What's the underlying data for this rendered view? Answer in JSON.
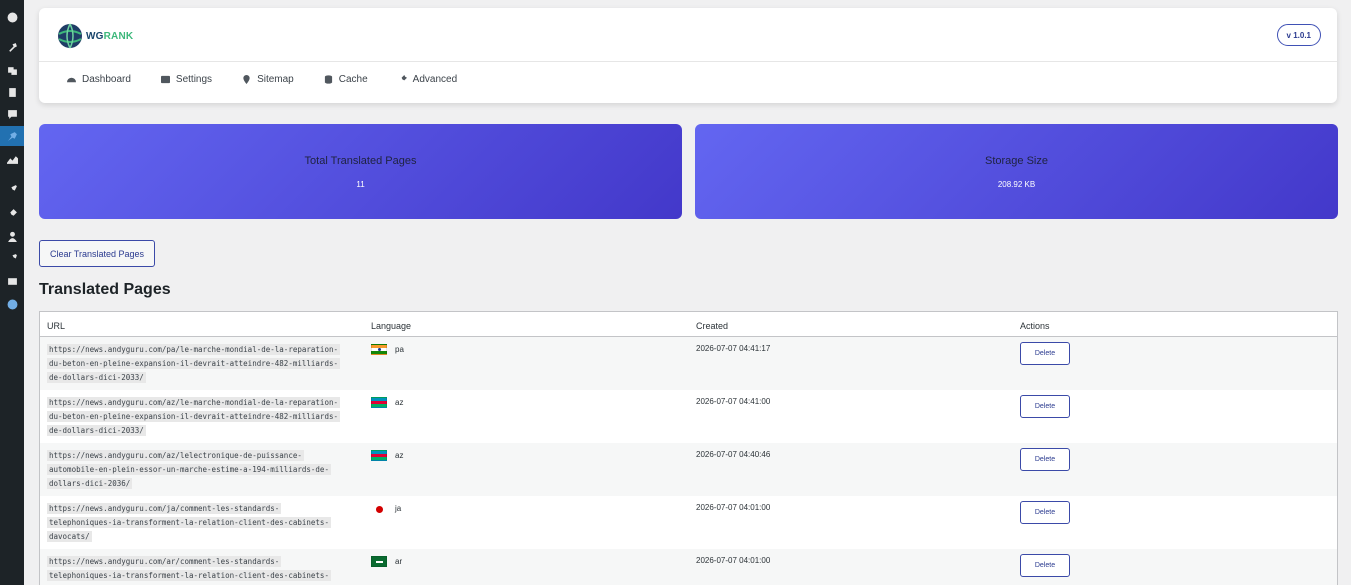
{
  "header": {
    "logo_text_wg": "WG",
    "logo_text_rank": "RANK",
    "version": "v 1.0.1"
  },
  "nav": [
    {
      "label": "Dashboard",
      "icon": "dashboard-icon"
    },
    {
      "label": "Settings",
      "icon": "settings-icon"
    },
    {
      "label": "Sitemap",
      "icon": "map-pin-icon"
    },
    {
      "label": "Cache",
      "icon": "database-icon"
    },
    {
      "label": "Advanced",
      "icon": "wrench-icon"
    }
  ],
  "stats": {
    "total_title": "Total Translated Pages",
    "total_value": "11",
    "storage_title": "Storage Size",
    "storage_value": "208.92 KB"
  },
  "clear_button": "Clear Translated Pages",
  "section_title": "Translated Pages",
  "table": {
    "headers": [
      "URL",
      "Language",
      "Created",
      "Actions"
    ],
    "rows": [
      {
        "url": "https://news.andyguru.com/pa/le-marche-mondial-de-la-reparation-du-beton-en-pleine-expansion-il-devrait-atteindre-482-milliards-de-dollars-dici-2033/",
        "lang": "pa",
        "created": "2026-07-07 04:41:17",
        "action": "Delete"
      },
      {
        "url": "https://news.andyguru.com/az/le-marche-mondial-de-la-reparation-du-beton-en-pleine-expansion-il-devrait-atteindre-482-milliards-de-dollars-dici-2033/",
        "lang": "az",
        "created": "2026-07-07 04:41:00",
        "action": "Delete"
      },
      {
        "url": "https://news.andyguru.com/az/lelectronique-de-puissance-automobile-en-plein-essor-un-marche-estime-a-194-milliards-de-dollars-dici-2036/",
        "lang": "az",
        "created": "2026-07-07 04:40:46",
        "action": "Delete"
      },
      {
        "url": "https://news.andyguru.com/ja/comment-les-standards-telephoniques-ia-transforment-la-relation-client-des-cabinets-davocats/",
        "lang": "ja",
        "created": "2026-07-07 04:01:00",
        "action": "Delete"
      },
      {
        "url": "https://news.andyguru.com/ar/comment-les-standards-telephoniques-ia-transforment-la-relation-client-des-cabinets-",
        "lang": "ar",
        "created": "2026-07-07 04:01:00",
        "action": "Delete"
      }
    ],
    "url_lines": [
      [
        "https://news.andyguru.com/pa/le-marche-mondial-de-la-reparation-",
        "du-beton-en-pleine-expansion-il-devrait-atteindre-482-milliards-",
        "de-dollars-dici-2033/"
      ],
      [
        "https://news.andyguru.com/az/le-marche-mondial-de-la-reparation-",
        "du-beton-en-pleine-expansion-il-devrait-atteindre-482-milliards-",
        "de-dollars-dici-2033/"
      ],
      [
        "https://news.andyguru.com/az/lelectronique-de-puissance-",
        "automobile-en-plein-essor-un-marche-estime-a-194-milliards-de-",
        "dollars-dici-2036/"
      ],
      [
        "https://news.andyguru.com/ja/comment-les-standards-",
        "telephoniques-ia-transforment-la-relation-client-des-cabinets-",
        "davocats/"
      ],
      [
        "https://news.andyguru.com/ar/comment-les-standards-",
        "telephoniques-ia-transforment-la-relation-client-des-cabinets-",
        ""
      ]
    ]
  },
  "colors": {
    "accent": "#3b4aa8",
    "card_gradient_start": "#6366f1",
    "card_gradient_end": "#4338ca",
    "sidebar_bg": "#1d2327",
    "sidebar_active": "#2271b1"
  }
}
